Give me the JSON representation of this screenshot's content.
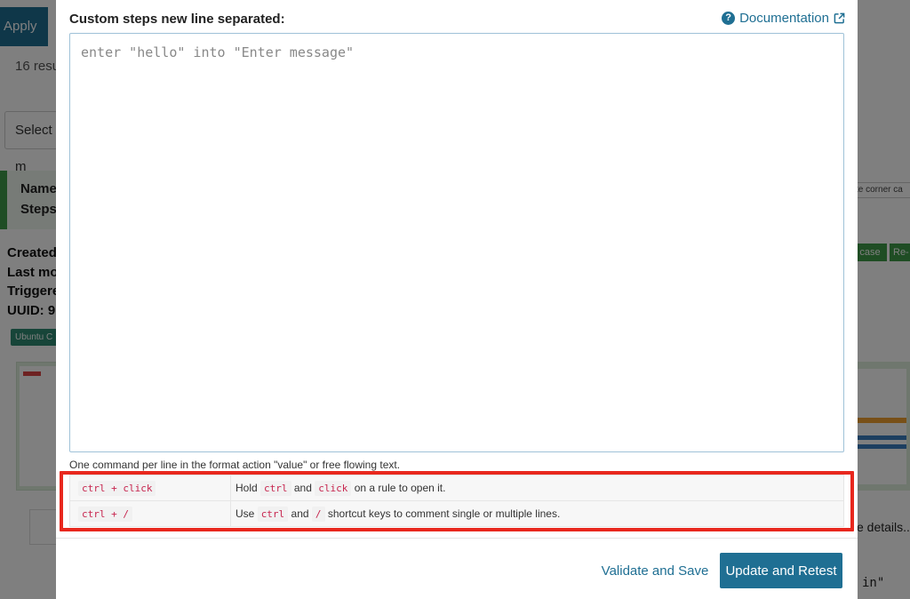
{
  "background": {
    "apply_label": "Apply",
    "results_text": "16 resu",
    "select_text": "Select m",
    "name_label": "Name",
    "steps_label": "Steps:",
    "meta_labels": [
      "Created",
      "Last mod",
      "Triggere",
      "UUID: 9"
    ],
    "tag_label": "Ubuntu C",
    "corner_text": "te corner ca",
    "btn1_label": "case",
    "btn2_label": "Re-",
    "details_text": "e details...",
    "code_tail": "in\""
  },
  "modal": {
    "title": "Custom steps new line separated:",
    "doc_label": "Documentation",
    "steps_placeholder": "enter \"hello\" into \"Enter message\"",
    "steps_value": "",
    "hint": "One command per line in the format action \"value\" or free flowing text.",
    "shortcuts": [
      {
        "keys": "ctrl + click",
        "desc_pre": "Hold",
        "code1": "ctrl",
        "desc_mid": "and",
        "code2": "click",
        "desc_post": "on a rule to open it."
      },
      {
        "keys": "ctrl + /",
        "desc_pre": "Use",
        "code1": "ctrl",
        "desc_mid": "and",
        "code2": "/",
        "desc_post": "shortcut keys to comment single or multiple lines."
      }
    ],
    "validate_label": "Validate and Save",
    "update_label": "Update and Retest"
  },
  "colors": {
    "accent": "#1f6f93",
    "highlight": "#e8281e",
    "code_text": "#c7254e"
  }
}
